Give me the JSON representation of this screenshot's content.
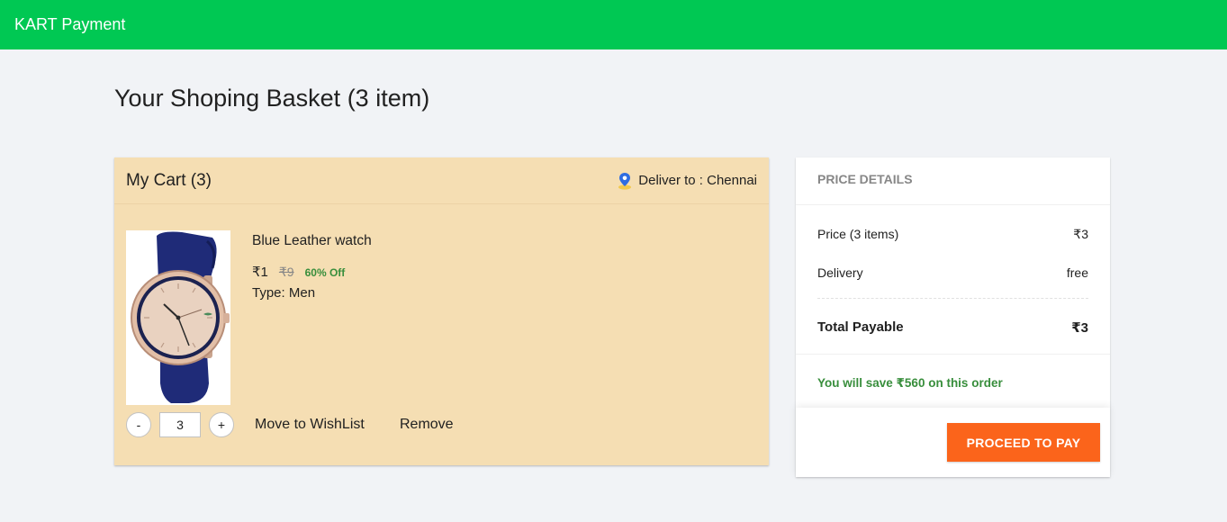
{
  "colors": {
    "topbar": "#00c853",
    "page_bg": "#f1f3f6",
    "cart_bg": "#f5deb3",
    "discount": "#388e3c",
    "proceed_button": "#fb641b"
  },
  "header": {
    "brand": "KART Payment"
  },
  "page": {
    "title": "Your Shoping Basket (3 item)"
  },
  "cart": {
    "title": "My Cart (3)",
    "location_icon": "map-pin-icon",
    "deliver_to": "Deliver to : Chennai",
    "items": [
      {
        "name": "Blue Leather watch",
        "image": "wristwatch-image",
        "price": "₹1",
        "mrp": "₹9",
        "discount": "60% Off",
        "type": "Type: Men",
        "quantity": "3",
        "decrement_label": "-",
        "increment_label": "+",
        "move_to_wishlist": "Move to WishList",
        "remove": "Remove"
      }
    ]
  },
  "price_details": {
    "title": "PRICE DETAILS",
    "price_label": "Price (3 items)",
    "price_value": "₹3",
    "delivery_label": "Delivery",
    "delivery_value": "free",
    "total_label": "Total Payable",
    "total_value": "₹3",
    "savings": "You will save ₹560 on this order",
    "proceed_label": "PROCEED TO PAY"
  }
}
